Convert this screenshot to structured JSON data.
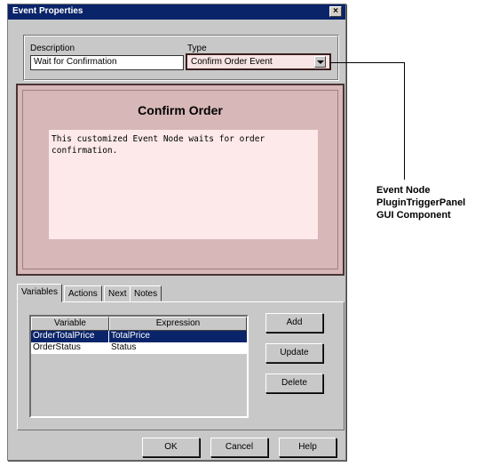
{
  "window": {
    "title": "Event Properties",
    "close_glyph": "×"
  },
  "form": {
    "description_label": "Description",
    "description_value": "Wait for Confirmation",
    "type_label": "Type",
    "type_value": "Confirm Order Event"
  },
  "plugin_panel": {
    "title": "Confirm Order",
    "description": "This customized Event Node waits for order\nconfirmation."
  },
  "tabs": [
    {
      "label": "Variables",
      "active": true
    },
    {
      "label": "Actions",
      "active": false
    },
    {
      "label": "Next",
      "active": false
    },
    {
      "label": "Notes",
      "active": false
    }
  ],
  "variables_table": {
    "columns": [
      "Variable",
      "Expression"
    ],
    "rows": [
      {
        "variable": "OrderTotalPrice",
        "expression": "TotalPrice",
        "selected": true
      },
      {
        "variable": "OrderStatus",
        "expression": "Status",
        "selected": false
      }
    ]
  },
  "table_buttons": {
    "add": "Add",
    "update": "Update",
    "delete": "Delete"
  },
  "dialog_buttons": {
    "ok": "OK",
    "cancel": "Cancel",
    "help": "Help"
  },
  "callout": {
    "line1": "Event Node",
    "line2": "PluginTriggerPanel",
    "line3": "GUI Component"
  },
  "colors": {
    "titlebar": "#0a246a",
    "plugin_panel": "#d7b7b7",
    "plugin_description_bg": "#fde9e9",
    "selection": "#0a246a"
  },
  "icons": {
    "combo_arrow": "chevron-down-icon",
    "close": "close-icon"
  }
}
